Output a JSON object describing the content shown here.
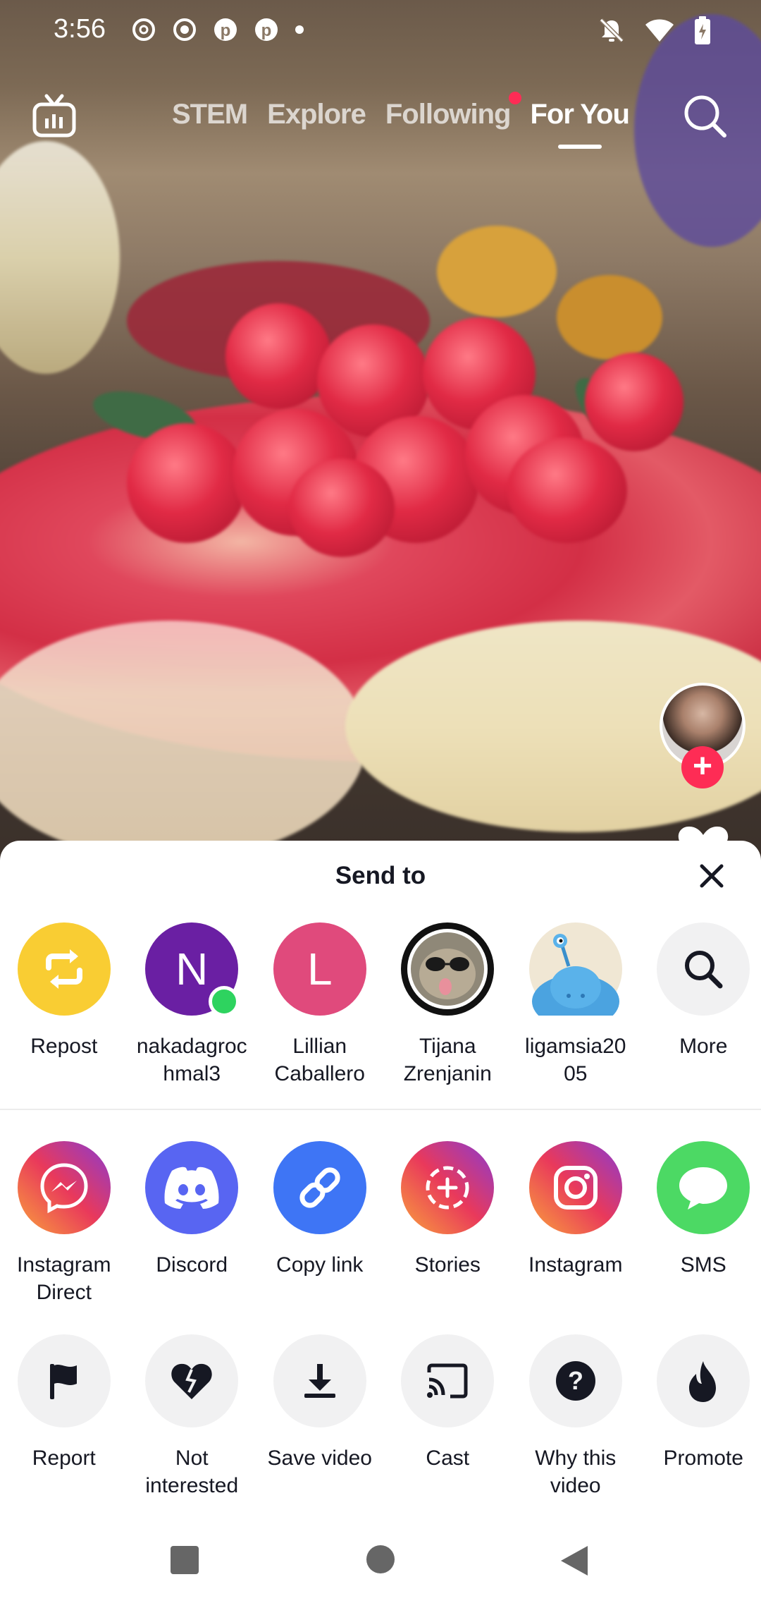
{
  "status_bar": {
    "time": "3:56",
    "left_icons": [
      "threads-icon",
      "record-icon",
      "pinterest-icon",
      "pinterest-icon",
      "dot-icon"
    ],
    "right_icons": [
      "bell-off-icon",
      "wifi-icon",
      "battery-charging-icon"
    ]
  },
  "top_nav": {
    "tabs": [
      {
        "label": "STEM",
        "active": false
      },
      {
        "label": "Explore",
        "active": false
      },
      {
        "label": "Following",
        "active": false,
        "has_notification_dot": true
      },
      {
        "label": "For You",
        "active": true
      }
    ]
  },
  "share_sheet": {
    "title": "Send to",
    "contacts": [
      {
        "label": "Repost",
        "kind": "repost",
        "color": "#f9cd33"
      },
      {
        "label": "nakadagroc\nhmal3",
        "kind": "letter",
        "letter": "N",
        "color": "#6a1fa3",
        "online": true
      },
      {
        "label": "Lillian\nCaballero",
        "kind": "letter",
        "letter": "L",
        "color": "#e04a7c"
      },
      {
        "label": "Tijana\nZrenjanin",
        "kind": "photo"
      },
      {
        "label": "ligamsia20\n05",
        "kind": "alien"
      },
      {
        "label": "More",
        "kind": "search"
      }
    ],
    "apps": [
      {
        "label": "Instagram\nDirect",
        "icon": "messenger-icon"
      },
      {
        "label": "Discord",
        "icon": "discord-icon",
        "color": "#5865f2"
      },
      {
        "label": "Copy link",
        "icon": "link-icon",
        "color": "#3e75f5"
      },
      {
        "label": "Stories",
        "icon": "stories-icon"
      },
      {
        "label": "Instagram",
        "icon": "instagram-icon"
      },
      {
        "label": "SMS",
        "icon": "sms-icon",
        "color": "#4cd964"
      }
    ],
    "actions": [
      {
        "label": "Report",
        "icon": "flag-icon"
      },
      {
        "label": "Not\ninterested",
        "icon": "broken-heart-icon"
      },
      {
        "label": "Save video",
        "icon": "download-icon"
      },
      {
        "label": "Cast",
        "icon": "cast-icon"
      },
      {
        "label": "Why this\nvideo",
        "icon": "question-icon"
      },
      {
        "label": "Promote",
        "icon": "flame-icon"
      }
    ]
  },
  "colors": {
    "accent": "#fe2c55",
    "text": "#161823"
  }
}
